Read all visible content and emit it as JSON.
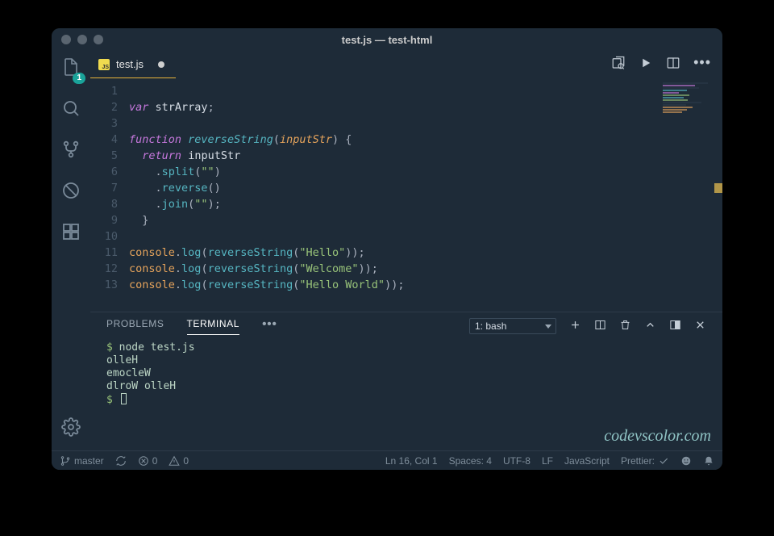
{
  "window": {
    "title": "test.js — test-html"
  },
  "tabs": [
    {
      "label": "test.js",
      "dirty": true,
      "lang": "JS"
    }
  ],
  "activity": {
    "explorer_badge": "1"
  },
  "code": {
    "lines": [
      {
        "n": 1,
        "tokens": []
      },
      {
        "n": 2,
        "tokens": [
          [
            "kw",
            "var"
          ],
          [
            "punc",
            " "
          ],
          [
            "ident",
            "strArray"
          ],
          [
            "punc",
            ";"
          ]
        ]
      },
      {
        "n": 3,
        "tokens": []
      },
      {
        "n": 4,
        "tokens": [
          [
            "kw",
            "function"
          ],
          [
            "punc",
            " "
          ],
          [
            "fnname",
            "reverseString"
          ],
          [
            "punc",
            "("
          ],
          [
            "param",
            "inputStr"
          ],
          [
            "punc",
            ") {"
          ]
        ]
      },
      {
        "n": 5,
        "tokens": [
          [
            "punc",
            "  "
          ],
          [
            "kw2",
            "return"
          ],
          [
            "punc",
            " "
          ],
          [
            "ident",
            "inputStr"
          ]
        ]
      },
      {
        "n": 6,
        "tokens": [
          [
            "punc",
            "    ."
          ],
          [
            "method",
            "split"
          ],
          [
            "punc",
            "("
          ],
          [
            "str",
            "\"\""
          ],
          [
            "punc",
            ")"
          ]
        ]
      },
      {
        "n": 7,
        "tokens": [
          [
            "punc",
            "    ."
          ],
          [
            "method",
            "reverse"
          ],
          [
            "punc",
            "()"
          ]
        ]
      },
      {
        "n": 8,
        "tokens": [
          [
            "punc",
            "    ."
          ],
          [
            "method",
            "join"
          ],
          [
            "punc",
            "("
          ],
          [
            "str",
            "\"\""
          ],
          [
            "punc",
            ");"
          ]
        ]
      },
      {
        "n": 9,
        "tokens": [
          [
            "punc",
            "  }"
          ]
        ]
      },
      {
        "n": 10,
        "tokens": []
      },
      {
        "n": 11,
        "tokens": [
          [
            "obj",
            "console"
          ],
          [
            "punc",
            "."
          ],
          [
            "method",
            "log"
          ],
          [
            "punc",
            "("
          ],
          [
            "call",
            "reverseString"
          ],
          [
            "punc",
            "("
          ],
          [
            "str",
            "\"Hello\""
          ],
          [
            "punc",
            "));"
          ]
        ]
      },
      {
        "n": 12,
        "tokens": [
          [
            "obj",
            "console"
          ],
          [
            "punc",
            "."
          ],
          [
            "method",
            "log"
          ],
          [
            "punc",
            "("
          ],
          [
            "call",
            "reverseString"
          ],
          [
            "punc",
            "("
          ],
          [
            "str",
            "\"Welcome\""
          ],
          [
            "punc",
            "));"
          ]
        ]
      },
      {
        "n": 13,
        "tokens": [
          [
            "obj",
            "console"
          ],
          [
            "punc",
            "."
          ],
          [
            "method",
            "log"
          ],
          [
            "punc",
            "("
          ],
          [
            "call",
            "reverseString"
          ],
          [
            "punc",
            "("
          ],
          [
            "str",
            "\"Hello World\""
          ],
          [
            "punc",
            "));"
          ]
        ]
      }
    ]
  },
  "panel": {
    "tabs": {
      "problems": "PROBLEMS",
      "terminal": "TERMINAL"
    },
    "terminal_select": "1: bash",
    "lines": [
      "$ node test.js",
      "olleH",
      "emocleW",
      "dlroW olleH",
      "$ "
    ]
  },
  "watermark": "codevscolor.com",
  "status": {
    "branch": "master",
    "errors": "0",
    "warnings": "0",
    "cursor": "Ln 16, Col 1",
    "spaces": "Spaces: 4",
    "encoding": "UTF-8",
    "eol": "LF",
    "lang": "JavaScript",
    "prettier": "Prettier:"
  }
}
